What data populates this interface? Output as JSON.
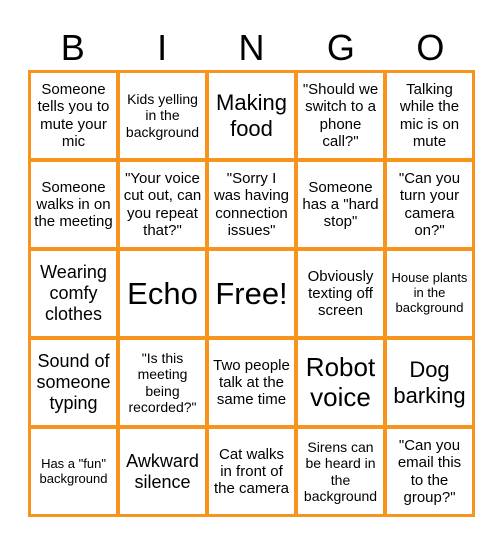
{
  "header": {
    "letters": [
      "B",
      "I",
      "N",
      "G",
      "O"
    ]
  },
  "colors": {
    "border": "#F7941D",
    "cell_background": "#FFFFFF",
    "text": "#000000"
  },
  "cells": [
    "Someone tells you to mute your mic",
    "Kids yelling in the background",
    "Making food",
    "\"Should we switch to a phone call?\"",
    "Talking while the mic is on mute",
    "Someone walks in on the meeting",
    "\"Your voice cut out, can you repeat that?\"",
    "\"Sorry I was having connection issues\"",
    "Someone has a \"hard stop\"",
    "\"Can you turn your camera on?\"",
    "Wearing comfy clothes",
    "Echo",
    "Free!",
    "Obviously texting off screen",
    "House plants in the background",
    "Sound of someone typing",
    "\"Is this meeting being recorded?\"",
    "Two people talk at the same time",
    "Robot voice",
    "Dog barking",
    "Has a \"fun\" background",
    "Awkward silence",
    "Cat walks in front of the camera",
    "Sirens can be heard in the background",
    "\"Can you email this to the group?\""
  ]
}
